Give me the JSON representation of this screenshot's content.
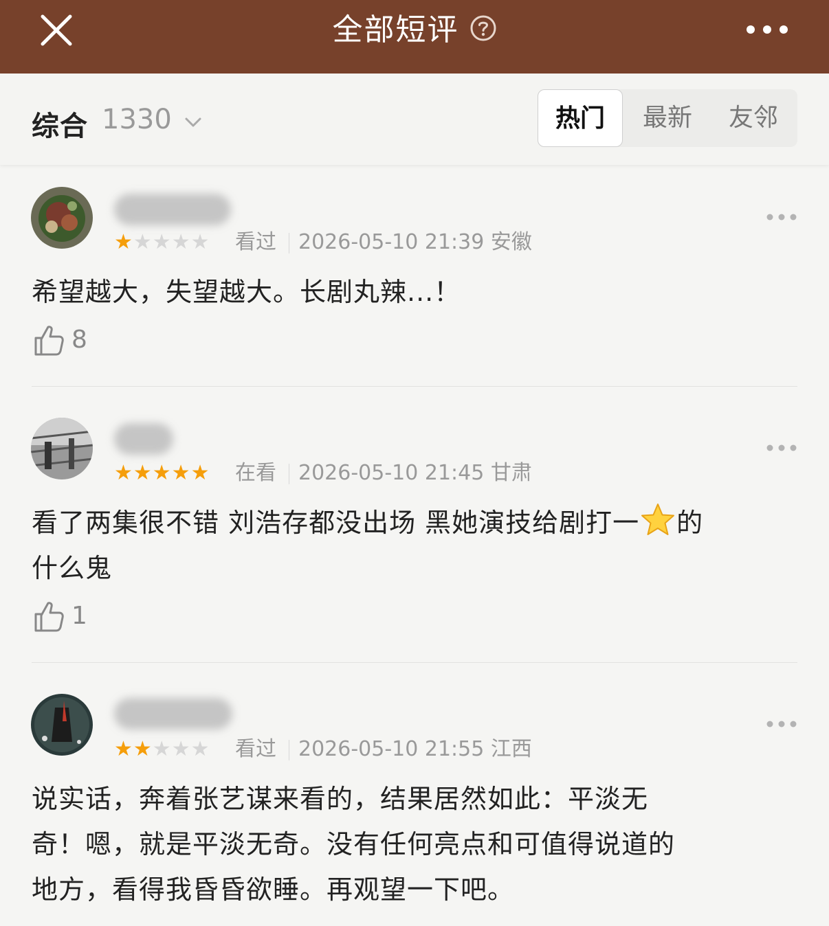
{
  "header": {
    "title": "全部短评"
  },
  "filter": {
    "sort_label": "综合",
    "count": "1330",
    "tabs": [
      "热门",
      "最新",
      "友邻"
    ],
    "active_tab": "热门"
  },
  "reviews": [
    {
      "rating": 1,
      "stars_max": 5,
      "status": "看过",
      "datetime": "2026-05-10 21:39 安徽",
      "content": "希望越大，失望越大。长剧丸辣...！",
      "likes": "8"
    },
    {
      "rating": 5,
      "stars_max": 5,
      "status": "在看",
      "datetime": "2026-05-10 21:45 甘肃",
      "content_a": "看了两集很不错 刘浩存都没出场 黑她演技给剧打一",
      "content_b": "的",
      "content_c": "什么鬼",
      "likes": "1"
    },
    {
      "rating": 2,
      "stars_max": 5,
      "status": "看过",
      "datetime": "2026-05-10 21:55 江西",
      "content_l1": "说实话，奔着张艺谋来看的，结果居然如此：平淡无",
      "content_l2": "奇！嗯，就是平淡无奇。没有任何亮点和可值得说道的",
      "content_l3": "地方，看得我昏昏欲睡。再观望一下吧。"
    }
  ],
  "colors": {
    "topbar": "#77412b",
    "star": "#f59e0b",
    "star_off": "#d6d6d6"
  }
}
